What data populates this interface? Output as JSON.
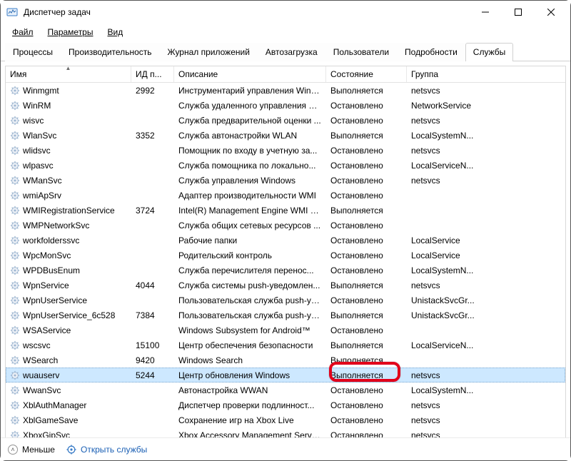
{
  "window": {
    "title": "Диспетчер задач"
  },
  "menubar": {
    "file": "Файл",
    "options": "Параметры",
    "view": "Вид"
  },
  "tabs": {
    "processes": "Процессы",
    "performance": "Производительность",
    "app_history": "Журнал приложений",
    "startup": "Автозагрузка",
    "users": "Пользователи",
    "details": "Подробности",
    "services": "Службы"
  },
  "columns": {
    "name": "Имя",
    "pid": "ИД п...",
    "desc": "Описание",
    "state": "Состояние",
    "group": "Группа"
  },
  "footer": {
    "less": "Меньше",
    "open_services": "Открыть службы"
  },
  "status": {
    "running": "Выполняется",
    "stopped": "Остановлено"
  },
  "rows": [
    {
      "name": "Winmgmt",
      "pid": "2992",
      "desc": "Инструментарий управления Wind...",
      "state": "Выполняется",
      "group": "netsvcs",
      "selected": false
    },
    {
      "name": "WinRM",
      "pid": "",
      "desc": "Служба удаленного управления W...",
      "state": "Остановлено",
      "group": "NetworkService",
      "selected": false
    },
    {
      "name": "wisvc",
      "pid": "",
      "desc": "Служба предварительной оценки ...",
      "state": "Остановлено",
      "group": "netsvcs",
      "selected": false
    },
    {
      "name": "WlanSvc",
      "pid": "3352",
      "desc": "Служба автонастройки WLAN",
      "state": "Выполняется",
      "group": "LocalSystemN...",
      "selected": false
    },
    {
      "name": "wlidsvc",
      "pid": "",
      "desc": "Помощник по входу в учетную за...",
      "state": "Остановлено",
      "group": "netsvcs",
      "selected": false
    },
    {
      "name": "wlpasvc",
      "pid": "",
      "desc": "Служба помощника по локально...",
      "state": "Остановлено",
      "group": "LocalServiceN...",
      "selected": false
    },
    {
      "name": "WManSvc",
      "pid": "",
      "desc": "Служба управления Windows",
      "state": "Остановлено",
      "group": "netsvcs",
      "selected": false
    },
    {
      "name": "wmiApSrv",
      "pid": "",
      "desc": "Адаптер производительности WMI",
      "state": "Остановлено",
      "group": "",
      "selected": false
    },
    {
      "name": "WMIRegistrationService",
      "pid": "3724",
      "desc": "Intel(R) Management Engine WMI Pr...",
      "state": "Выполняется",
      "group": "",
      "selected": false
    },
    {
      "name": "WMPNetworkSvc",
      "pid": "",
      "desc": "Служба общих сетевых ресурсов ...",
      "state": "Остановлено",
      "group": "",
      "selected": false
    },
    {
      "name": "workfolderssvc",
      "pid": "",
      "desc": "Рабочие папки",
      "state": "Остановлено",
      "group": "LocalService",
      "selected": false
    },
    {
      "name": "WpcMonSvc",
      "pid": "",
      "desc": "Родительский контроль",
      "state": "Остановлено",
      "group": "LocalService",
      "selected": false
    },
    {
      "name": "WPDBusEnum",
      "pid": "",
      "desc": "Служба перечислителя перенос...",
      "state": "Остановлено",
      "group": "LocalSystemN...",
      "selected": false
    },
    {
      "name": "WpnService",
      "pid": "4044",
      "desc": "Служба системы push-уведомлен...",
      "state": "Выполняется",
      "group": "netsvcs",
      "selected": false
    },
    {
      "name": "WpnUserService",
      "pid": "",
      "desc": "Пользовательская служба push-ув...",
      "state": "Остановлено",
      "group": "UnistackSvcGr...",
      "selected": false
    },
    {
      "name": "WpnUserService_6c528",
      "pid": "7384",
      "desc": "Пользовательская служба push-ув...",
      "state": "Выполняется",
      "group": "UnistackSvcGr...",
      "selected": false
    },
    {
      "name": "WSAService",
      "pid": "",
      "desc": "Windows Subsystem for Android™",
      "state": "Остановлено",
      "group": "",
      "selected": false
    },
    {
      "name": "wscsvc",
      "pid": "15100",
      "desc": "Центр обеспечения безопасности",
      "state": "Выполняется",
      "group": "LocalServiceN...",
      "selected": false
    },
    {
      "name": "WSearch",
      "pid": "9420",
      "desc": "Windows Search",
      "state": "Выполняется",
      "group": "",
      "selected": false
    },
    {
      "name": "wuauserv",
      "pid": "5244",
      "desc": "Центр обновления Windows",
      "state": "Выполняется",
      "group": "netsvcs",
      "selected": true
    },
    {
      "name": "WwanSvc",
      "pid": "",
      "desc": "Автонастройка WWAN",
      "state": "Остановлено",
      "group": "LocalSystemN...",
      "selected": false
    },
    {
      "name": "XblAuthManager",
      "pid": "",
      "desc": "Диспетчер проверки подлинност...",
      "state": "Остановлено",
      "group": "netsvcs",
      "selected": false
    },
    {
      "name": "XblGameSave",
      "pid": "",
      "desc": "Сохранение игр на Xbox Live",
      "state": "Остановлено",
      "group": "netsvcs",
      "selected": false
    },
    {
      "name": "XboxGipSvc",
      "pid": "",
      "desc": "Xbox Accessory Management Service",
      "state": "Остановлено",
      "group": "netsvcs",
      "selected": false
    }
  ]
}
